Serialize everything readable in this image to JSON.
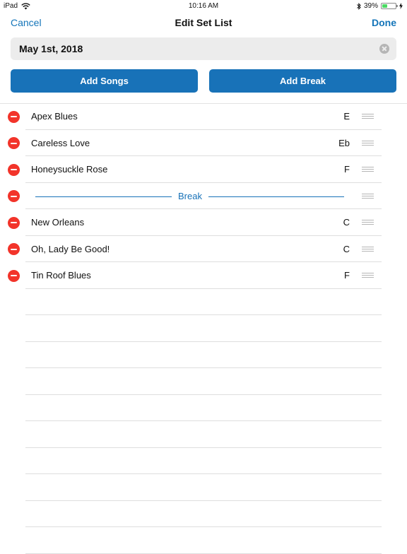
{
  "status_bar": {
    "device": "iPad",
    "time": "10:16 AM",
    "battery_percent": "39%",
    "battery_level": 0.39
  },
  "nav": {
    "cancel_label": "Cancel",
    "title": "Edit Set List",
    "done_label": "Done"
  },
  "set_title": {
    "value": "May 1st, 2018"
  },
  "actions": {
    "add_songs_label": "Add Songs",
    "add_break_label": "Add Break"
  },
  "set_list": [
    {
      "type": "song",
      "title": "Apex Blues",
      "key": "E"
    },
    {
      "type": "song",
      "title": "Careless Love",
      "key": "Eb"
    },
    {
      "type": "song",
      "title": "Honeysuckle Rose",
      "key": "F"
    },
    {
      "type": "break",
      "label": "Break"
    },
    {
      "type": "song",
      "title": "New Orleans",
      "key": "C"
    },
    {
      "type": "song",
      "title": "Oh, Lady Be Good!",
      "key": "C"
    },
    {
      "type": "song",
      "title": "Tin Roof Blues",
      "key": "F"
    }
  ],
  "colors": {
    "accent": "#1872b8",
    "delete": "#f2342a",
    "battery": "#4cd964"
  }
}
